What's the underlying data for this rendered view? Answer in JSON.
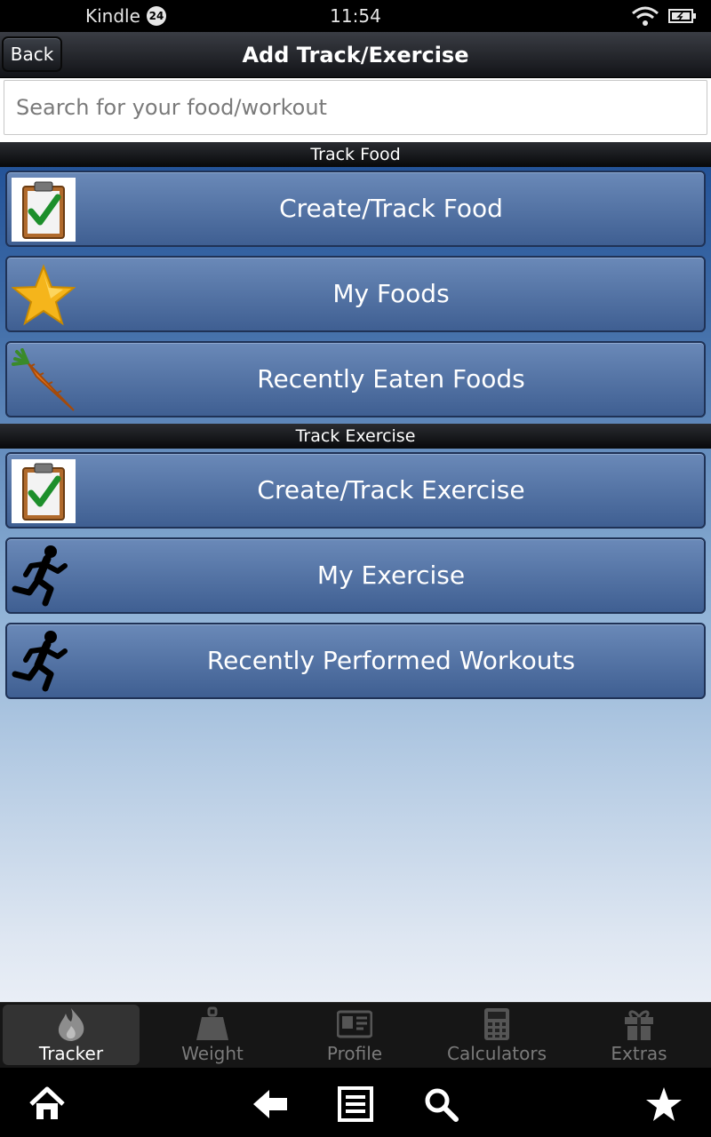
{
  "status_bar": {
    "carrier": "Kindle",
    "notification_count": "24",
    "time": "11:54"
  },
  "header": {
    "back_label": "Back",
    "title": "Add Track/Exercise"
  },
  "search": {
    "placeholder": "Search for your food/workout",
    "value": ""
  },
  "sections": [
    {
      "title": "Track Food",
      "items": [
        {
          "label": "Create/Track Food",
          "icon": "clipboard-check-icon"
        },
        {
          "label": "My Foods",
          "icon": "star-icon"
        },
        {
          "label": "Recently Eaten Foods",
          "icon": "carrot-icon"
        }
      ]
    },
    {
      "title": "Track Exercise",
      "items": [
        {
          "label": "Create/Track Exercise",
          "icon": "clipboard-check-icon"
        },
        {
          "label": "My Exercise",
          "icon": "runner-icon"
        },
        {
          "label": "Recently Performed Workouts",
          "icon": "runner-icon"
        }
      ]
    }
  ],
  "tabs": [
    {
      "label": "Tracker",
      "icon": "flame-icon",
      "active": true
    },
    {
      "label": "Weight",
      "icon": "weight-icon",
      "active": false
    },
    {
      "label": "Profile",
      "icon": "id-card-icon",
      "active": false
    },
    {
      "label": "Calculators",
      "icon": "calculator-icon",
      "active": false
    },
    {
      "label": "Extras",
      "icon": "gift-icon",
      "active": false
    }
  ],
  "nav": [
    "home-icon",
    "back-arrow-icon",
    "menu-icon",
    "search-icon",
    "favorite-star-icon"
  ],
  "colors": {
    "accent": "#3f5f92",
    "header_dark": "#121317",
    "content_top": "#1f4f96"
  }
}
